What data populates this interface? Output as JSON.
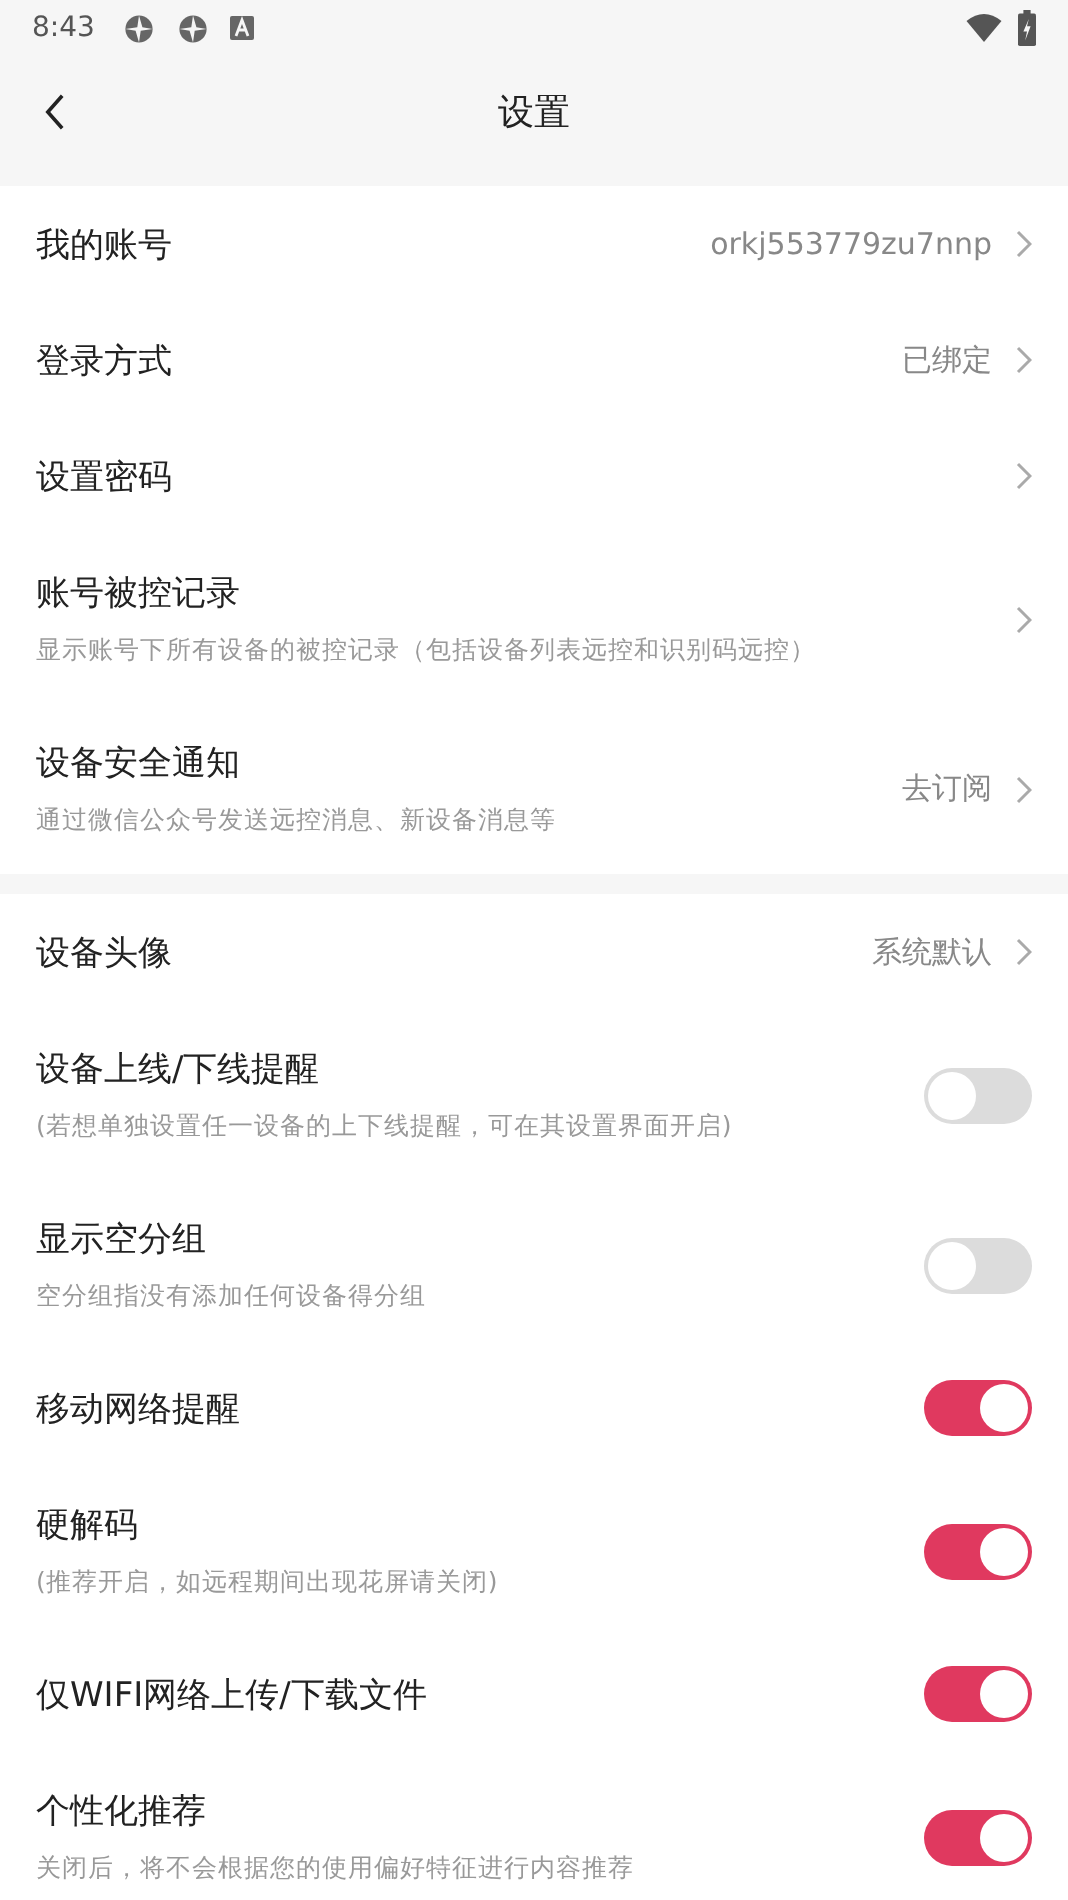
{
  "status_bar": {
    "time": "8:43"
  },
  "header": {
    "title": "设置"
  },
  "sections": [
    {
      "rows": [
        {
          "kind": "link",
          "title": "我的账号",
          "value": "orkj553779zu7nnp"
        },
        {
          "kind": "link",
          "title": "登录方式",
          "value": "已绑定"
        },
        {
          "kind": "link",
          "title": "设置密码"
        },
        {
          "kind": "link",
          "title": "账号被控记录",
          "subtitle": "显示账号下所有设备的被控记录（包括设备列表远控和识别码远控）"
        },
        {
          "kind": "link",
          "title": "设备安全通知",
          "subtitle": "通过微信公众号发送远控消息、新设备消息等",
          "value": "去订阅"
        }
      ]
    },
    {
      "rows": [
        {
          "kind": "link",
          "title": "设备头像",
          "value": "系统默认"
        },
        {
          "kind": "toggle",
          "title": "设备上线/下线提醒",
          "subtitle": "(若想单独设置任一设备的上下线提醒，可在其设置界面开启)",
          "on": false
        },
        {
          "kind": "toggle",
          "title": "显示空分组",
          "subtitle": "空分组指没有添加任何设备得分组",
          "on": false
        },
        {
          "kind": "toggle",
          "title": "移动网络提醒",
          "on": true
        },
        {
          "kind": "toggle",
          "title": "硬解码",
          "subtitle": "(推荐开启，如远程期间出现花屏请关闭)",
          "on": true
        },
        {
          "kind": "toggle",
          "title": "仅WIFI网络上传/下载文件",
          "on": true
        },
        {
          "kind": "toggle",
          "title": "个性化推荐",
          "subtitle": "关闭后，将不会根据您的使用偏好特征进行内容推荐",
          "on": true
        }
      ]
    }
  ]
}
